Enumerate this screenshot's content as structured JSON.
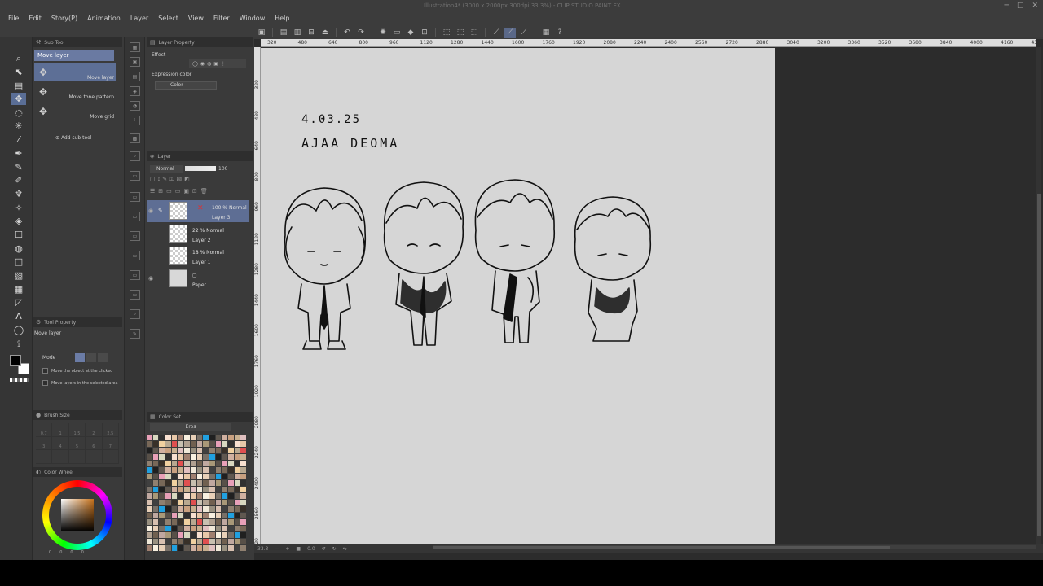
{
  "window": {
    "title": "Illustration4* (3000 x 2000px 300dpi 33.3%) - CLIP STUDIO PAINT EX"
  },
  "menu": [
    "File",
    "Edit",
    "Story(P)",
    "Animation",
    "Layer",
    "Select",
    "View",
    "Filter",
    "Window",
    "Help"
  ],
  "sub_tool": {
    "tab_label": "Sub Tool",
    "group_label": "Move layer",
    "items": [
      {
        "label": "Move layer"
      },
      {
        "label": "Move tone pattern"
      },
      {
        "label": "Move grid"
      }
    ],
    "add_label": "Add sub tool"
  },
  "tool_property": {
    "tab_label": "Tool Property",
    "tool_name": "Move layer",
    "mode_label": "Mode",
    "options": [
      "Move the object at the clicked",
      "Move layers in the selected area"
    ]
  },
  "brush_size": {
    "tab_label": "Brush Size",
    "sizes": [
      "0.7",
      "1",
      "1.5",
      "2",
      "2.5",
      "3",
      "4",
      "5",
      "6",
      "7"
    ]
  },
  "color_wheel": {
    "tab_label": "Color Wheel",
    "values": [
      "0",
      "0",
      "0",
      "0"
    ]
  },
  "layer_property": {
    "tab_label": "Layer Property",
    "effect_label": "Effect",
    "expression_label": "Expression color",
    "expression_value": "Color"
  },
  "layer_panel": {
    "tab_label": "Layer",
    "blend_mode": "Normal",
    "opacity": "100",
    "layers": [
      {
        "opacity_mode": "100 % Normal",
        "name": "Layer 3",
        "selected": true
      },
      {
        "opacity_mode": "22 % Normal",
        "name": "Layer 2",
        "selected": false
      },
      {
        "opacity_mode": "18 % Normal",
        "name": "Layer 1",
        "selected": false
      },
      {
        "opacity_mode": "",
        "name": "Paper",
        "selected": false
      }
    ]
  },
  "color_set": {
    "tab_label": "Color Set",
    "set_name": "Eros"
  },
  "canvas": {
    "date_text": "4.03.25",
    "title_text": "AJAA DEOMA",
    "zoom": "33.3",
    "angle": "0.0",
    "ruler_top": [
      "320",
      "480",
      "640",
      "800",
      "960",
      "1120",
      "1280",
      "1440",
      "1600",
      "1760",
      "1920",
      "2080",
      "2240",
      "2400",
      "2560",
      "2720",
      "2880",
      "3040",
      "3200",
      "3360",
      "3520",
      "3680",
      "3840",
      "4000",
      "4160",
      "4320"
    ],
    "ruler_left": [
      "320",
      "480",
      "640",
      "800",
      "960",
      "1120",
      "1280",
      "1440",
      "1600",
      "1760",
      "1920",
      "2080",
      "2240",
      "2400",
      "2560",
      "2720"
    ]
  },
  "colors": {
    "accent": "#5e6e94",
    "panel_bg": "#3a3a3a",
    "canvas_bg": "#d6d6d6"
  }
}
